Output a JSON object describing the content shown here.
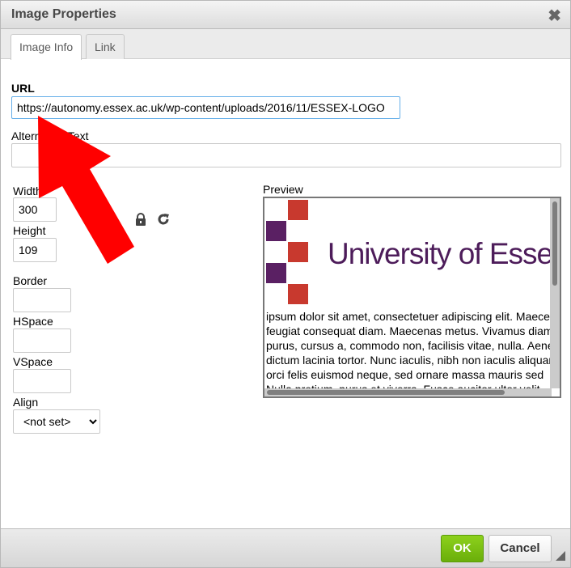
{
  "dialog": {
    "title": "Image Properties",
    "close_icon": "close-icon"
  },
  "tabs": [
    {
      "label": "Image Info",
      "active": true
    },
    {
      "label": "Link",
      "active": false
    }
  ],
  "fields": {
    "url_label": "URL",
    "url_value": "https://autonomy.essex.ac.uk/wp-content/uploads/2016/11/ESSEX-LOGO",
    "alt_label": "Alternative Text",
    "alt_value": "",
    "width_label": "Width",
    "width_value": "300",
    "height_label": "Height",
    "height_value": "109",
    "border_label": "Border",
    "border_value": "",
    "hspace_label": "HSpace",
    "hspace_value": "",
    "vspace_label": "VSpace",
    "vspace_value": "",
    "align_label": "Align",
    "align_value": "<not set>"
  },
  "icons": {
    "lock": "lock-icon",
    "reset": "reset-size-icon"
  },
  "preview": {
    "label": "Preview",
    "logo_text": "University of Essex",
    "lines": [
      "ipsum dolor sit amet, consectetuer adipiscing elit. Maecenas",
      "feugiat consequat diam. Maecenas metus. Vivamus diam",
      "purus, cursus a, commodo non, facilisis vitae, nulla. Aenean",
      "dictum lacinia tortor. Nunc iaculis, nibh non iaculis aliquam,",
      "orci felis euismod neque, sed ornare massa mauris sed",
      "Nulla pretium, purus et viverra. Fusce aucitor ultor velit"
    ],
    "colors": {
      "red": "#c8392e",
      "purple": "#5a2063"
    }
  },
  "footer": {
    "ok_label": "OK",
    "cancel_label": "Cancel",
    "ok_color": "#7cc115"
  },
  "annotation": {
    "arrow_color": "#ff0000"
  }
}
